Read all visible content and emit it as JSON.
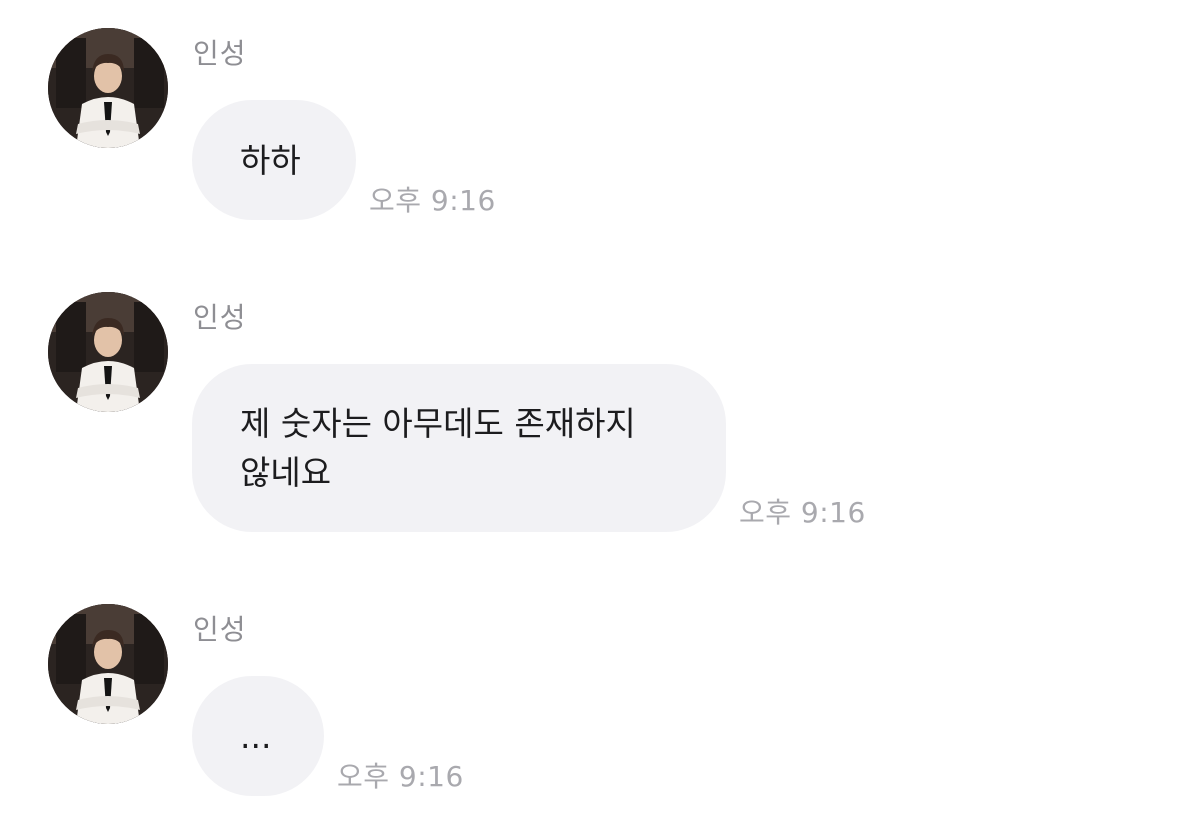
{
  "messages": [
    {
      "sender": "인성",
      "text": "하하",
      "time": "오후 9:16",
      "avatar_icon": "profile-photo"
    },
    {
      "sender": "인성",
      "text": "제 숫자는 아무데도 존재하지\n않네요",
      "time": "오후 9:16",
      "avatar_icon": "profile-photo"
    },
    {
      "sender": "인성",
      "text": "...",
      "time": "오후 9:16",
      "avatar_icon": "profile-photo"
    }
  ],
  "colors": {
    "bubble": "#f2f2f5",
    "sender_text": "#8e8e93",
    "time_text": "#a9a9ae",
    "message_text": "#1c1c1e"
  }
}
